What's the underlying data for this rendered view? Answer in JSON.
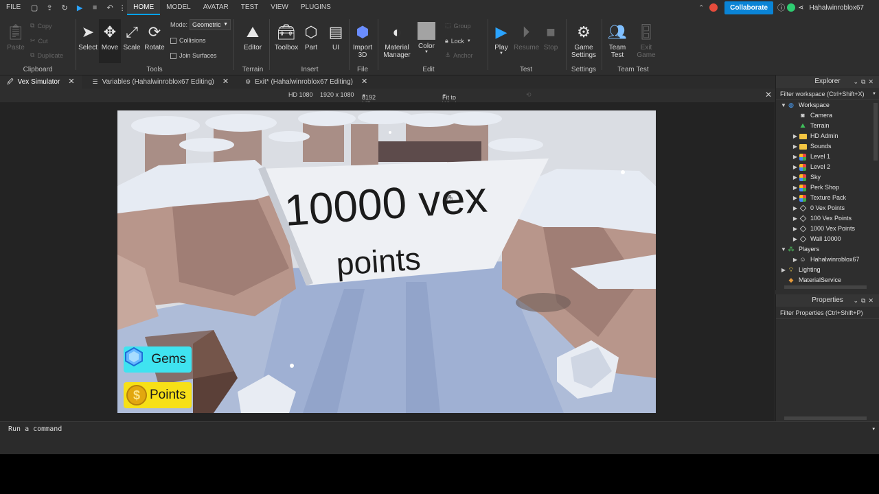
{
  "menu": {
    "file": "FILE",
    "tabs": [
      "HOME",
      "MODEL",
      "AVATAR",
      "TEST",
      "VIEW",
      "PLUGINS"
    ],
    "active_tab": "HOME",
    "collaborate": "Collaborate",
    "username": "Hahalwinroblox67"
  },
  "ribbon": {
    "clipboard": {
      "paste": "Paste",
      "copy": "Copy",
      "cut": "Cut",
      "duplicate": "Duplicate",
      "group": "Clipboard"
    },
    "tools": {
      "select": "Select",
      "move": "Move",
      "scale": "Scale",
      "rotate": "Rotate",
      "mode_label": "Mode:",
      "mode_value": "Geometric",
      "collisions": "Collisions",
      "join_surfaces": "Join Surfaces",
      "group": "Tools"
    },
    "terrain": {
      "editor": "Editor",
      "group": "Terrain"
    },
    "insert": {
      "toolbox": "Toolbox",
      "part": "Part",
      "ui": "UI",
      "group": "Insert"
    },
    "file": {
      "import3d_line1": "Import",
      "import3d_line2": "3D",
      "group": "File"
    },
    "edit": {
      "material_line1": "Material",
      "material_line2": "Manager",
      "color": "Color",
      "group_btn": "Group",
      "lock": "Lock",
      "anchor": "Anchor",
      "group": "Edit"
    },
    "test": {
      "play": "Play",
      "resume": "Resume",
      "stop": "Stop",
      "group": "Test"
    },
    "settings": {
      "game_line1": "Game",
      "game_line2": "Settings",
      "group": "Settings"
    },
    "team_test": {
      "team_line1": "Team",
      "team_line2": "Test",
      "exit_line1": "Exit",
      "exit_line2": "Game",
      "group": "Team Test"
    }
  },
  "doc_tabs": [
    {
      "label": "Vex Simulator",
      "active": true
    },
    {
      "label": "Variables (Hahalwinroblox67 Editing)",
      "active": false
    },
    {
      "label": "Exit* (Hahalwinroblox67 Editing)",
      "active": false
    }
  ],
  "viewport_bar": {
    "resolution": "HD 1080",
    "size": "1920 x 1080",
    "memory": "8192 MB",
    "fit": "Fit to Window"
  },
  "game": {
    "sign_line1": "10000 vex",
    "sign_line2": "points",
    "hud_gems": "Gems",
    "hud_points": "Points"
  },
  "command_bar": {
    "placeholder": "Run a command"
  },
  "explorer": {
    "title": "Explorer",
    "filter": "Filter workspace (Ctrl+Shift+X)",
    "items": [
      {
        "label": "Workspace",
        "depth": 0,
        "arrow": "open",
        "icon": "globe-icon"
      },
      {
        "label": "Camera",
        "depth": 1,
        "arrow": "none",
        "icon": "camera-icon"
      },
      {
        "label": "Terrain",
        "depth": 1,
        "arrow": "none",
        "icon": "terrain-icon"
      },
      {
        "label": "HD Admin",
        "depth": 1,
        "arrow": "closed",
        "icon": "folder-icon"
      },
      {
        "label": "Sounds",
        "depth": 1,
        "arrow": "closed",
        "icon": "folder-icon"
      },
      {
        "label": "Level 1",
        "depth": 1,
        "arrow": "closed",
        "icon": "model-icon"
      },
      {
        "label": "Level 2",
        "depth": 1,
        "arrow": "closed",
        "icon": "model-icon"
      },
      {
        "label": "Sky",
        "depth": 1,
        "arrow": "closed",
        "icon": "model-icon"
      },
      {
        "label": "Perk Shop",
        "depth": 1,
        "arrow": "closed",
        "icon": "model-icon"
      },
      {
        "label": "Texture Pack",
        "depth": 1,
        "arrow": "closed",
        "icon": "model-icon"
      },
      {
        "label": "0 Vex Points",
        "depth": 1,
        "arrow": "closed",
        "icon": "part-icon"
      },
      {
        "label": "100 Vex Points",
        "depth": 1,
        "arrow": "closed",
        "icon": "part-icon"
      },
      {
        "label": "1000 Vex Points",
        "depth": 1,
        "arrow": "closed",
        "icon": "part-icon"
      },
      {
        "label": "Wall 10000",
        "depth": 1,
        "arrow": "closed",
        "icon": "part-icon"
      },
      {
        "label": "Players",
        "depth": 0,
        "arrow": "open",
        "icon": "players-icon"
      },
      {
        "label": "Hahalwinroblox67",
        "depth": 1,
        "arrow": "closed",
        "icon": "player-icon"
      },
      {
        "label": "Lighting",
        "depth": 0,
        "arrow": "closed",
        "icon": "lightbulb-icon"
      },
      {
        "label": "MaterialService",
        "depth": 0,
        "arrow": "none",
        "icon": "material-icon"
      }
    ]
  },
  "properties": {
    "title": "Properties",
    "filter": "Filter Properties (Ctrl+Shift+P)"
  },
  "colors": {
    "accent": "#00a2ff",
    "collaborate": "#0a84d6",
    "gems_bg": "#3fe3f0",
    "points_bg": "#f7e017"
  }
}
